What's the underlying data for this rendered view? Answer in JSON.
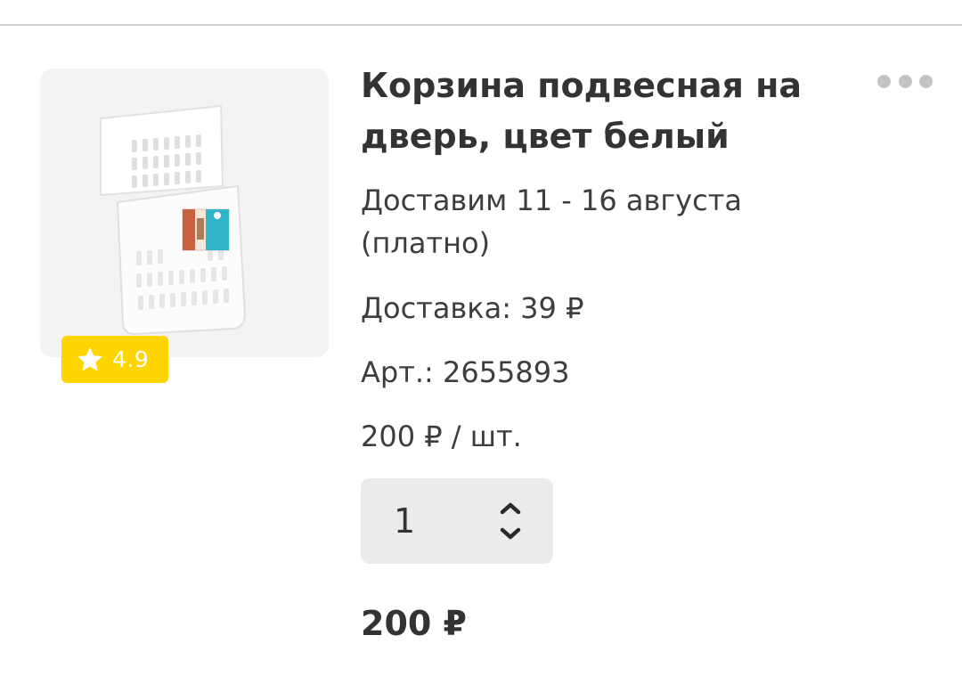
{
  "product": {
    "title": "Корзина подвесная на дверь, цвет белый",
    "image_icon": "hanging-basket-image",
    "rating": "4.9",
    "delivery_date": "Доставим 11 - 16 августа (платно)",
    "delivery_cost": "Доставка: 39 ₽",
    "sku": "Арт.: 2655893",
    "unit_price": "200 ₽ / шт.",
    "quantity": "1",
    "total_price": "200 ₽"
  },
  "icons": {
    "rating": "star-icon",
    "menu": "more-dots-icon",
    "stepper": "up-down-chevron-icon"
  },
  "colors": {
    "rating_badge": "#ffd500",
    "text": "#333333",
    "stepper_bg": "#ebebeb",
    "image_bg": "#f3f3f3"
  }
}
